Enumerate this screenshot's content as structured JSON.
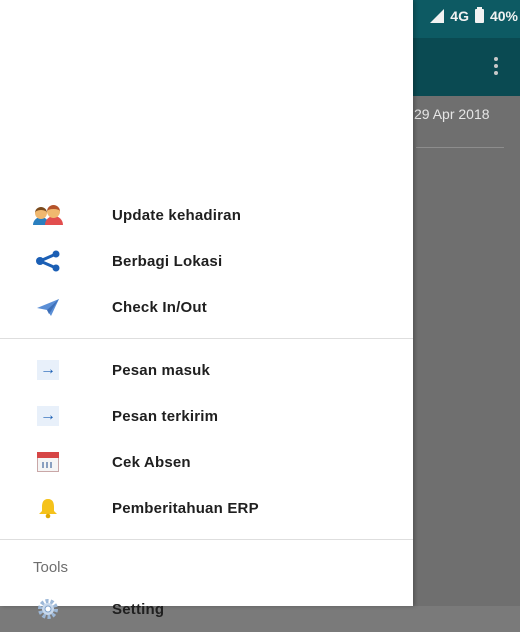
{
  "status_bar": {
    "network": "4G",
    "battery": "40%"
  },
  "background": {
    "date": "29 Apr 2018"
  },
  "drawer": {
    "group1": [
      {
        "label": "Update kehadiran",
        "icon": "people-icon"
      },
      {
        "label": "Berbagi Lokasi",
        "icon": "share-icon"
      },
      {
        "label": "Check In/Out",
        "icon": "send-icon"
      }
    ],
    "group2": [
      {
        "label": "Pesan masuk",
        "icon": "arrow-right-icon"
      },
      {
        "label": "Pesan terkirim",
        "icon": "arrow-right-icon"
      },
      {
        "label": "Cek Absen",
        "icon": "calendar-icon"
      },
      {
        "label": "Pemberitahuan ERP",
        "icon": "bell-icon"
      }
    ],
    "tools_title": "Tools",
    "tools": [
      {
        "label": "Setting",
        "icon": "gear-icon"
      }
    ]
  },
  "colors": {
    "app_bar": "#0a4a52",
    "share": "#1b5fb5",
    "bell": "#f5c21b"
  }
}
